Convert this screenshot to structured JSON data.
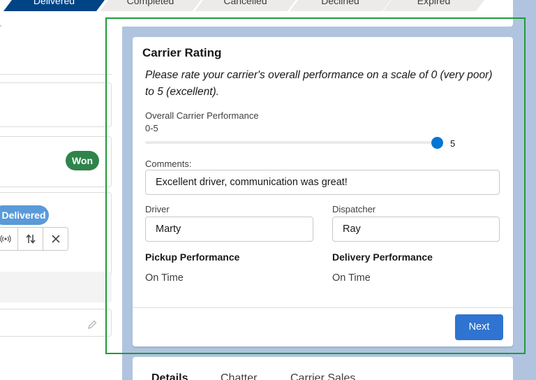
{
  "path": {
    "stages": [
      {
        "label": "Delivered",
        "active": true
      },
      {
        "label": "Completed",
        "active": false
      },
      {
        "label": "Cancelled",
        "active": false
      },
      {
        "label": "Declined",
        "active": false
      },
      {
        "label": "Expired",
        "active": false
      }
    ]
  },
  "left": {
    "won_badge": "Won",
    "status_badge": "Delivered",
    "icons": [
      "antenna-icon",
      "sort-arrows-icon",
      "close-icon",
      "pencil-icon"
    ]
  },
  "card": {
    "title": "Carrier Rating",
    "intro": "Please rate your carrier's overall performance on a scale of 0 (very poor) to 5 (excellent).",
    "rating": {
      "label": "Overall Carrier Performance",
      "range_label": "0-5",
      "min": 0,
      "max": 5,
      "value": 5,
      "value_label": "5"
    },
    "comments": {
      "label": "Comments:",
      "value": "Excellent driver, communication was great!"
    },
    "driver": {
      "label": "Driver",
      "value": "Marty"
    },
    "dispatcher": {
      "label": "Dispatcher",
      "value": "Ray"
    },
    "pickup": {
      "label": "Pickup Performance",
      "value": "On Time"
    },
    "delivery": {
      "label": "Delivery Performance",
      "value": "On Time"
    },
    "next_label": "Next"
  },
  "tabs": [
    {
      "label": "Details",
      "active": true
    },
    {
      "label": "Chatter",
      "active": false
    },
    {
      "label": "Carrier Sales",
      "active": false
    }
  ],
  "colors": {
    "background": "#b0c4df",
    "primary": "#0176d3",
    "button": "#2f74d0",
    "won": "#2e844a",
    "status": "#5a9ad8",
    "active_stage": "#014486",
    "selection": "#1f9b3a"
  }
}
